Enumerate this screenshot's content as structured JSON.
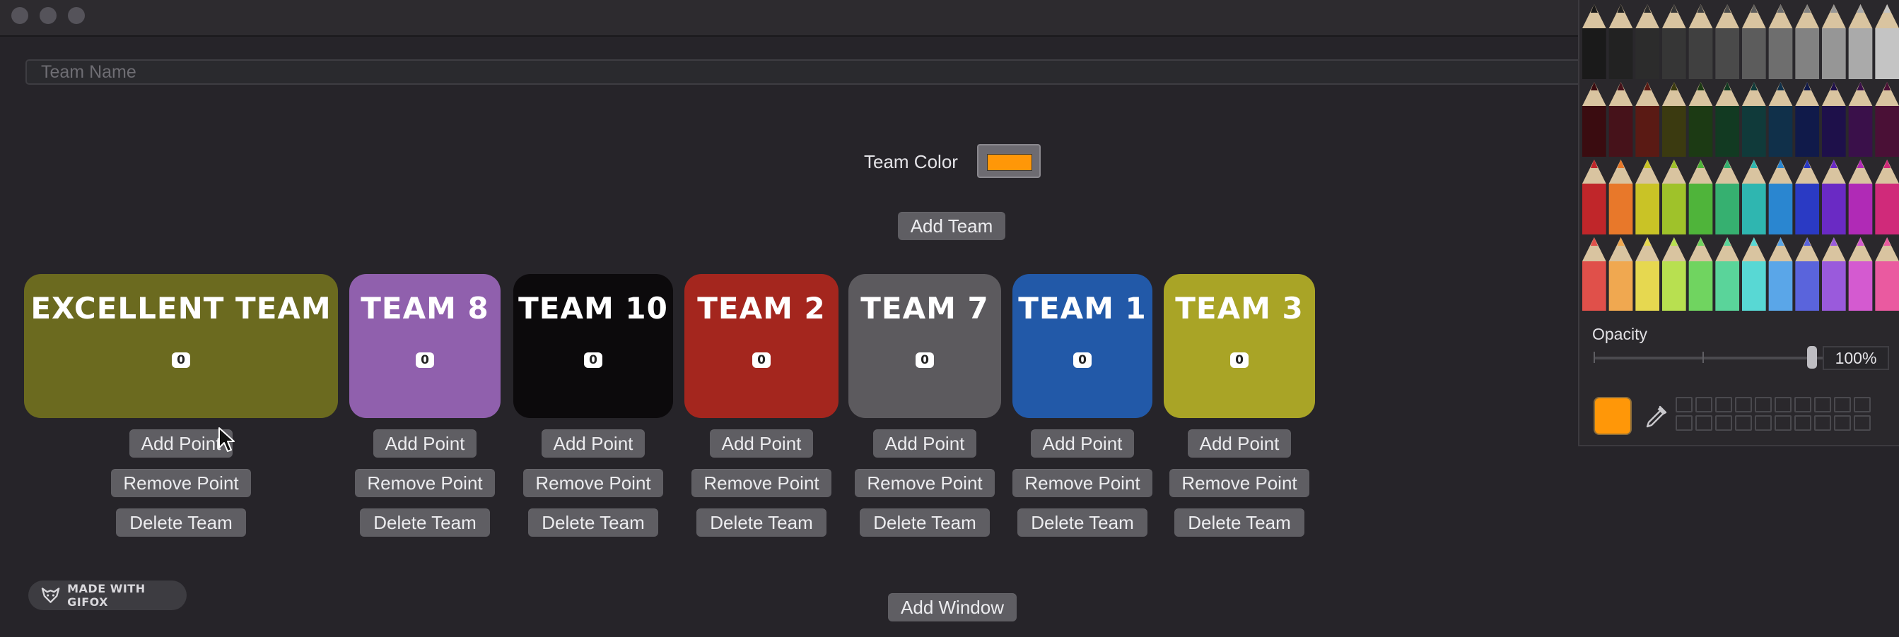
{
  "team_name": {
    "placeholder": "Team Name"
  },
  "team_color": {
    "label": "Team Color",
    "value": "#ff9708"
  },
  "add_team_label": "Add Team",
  "add_window_label": "Add Window",
  "card_buttons": {
    "add_point": "Add Point",
    "remove_point": "Remove Point",
    "delete_team": "Delete Team"
  },
  "teams": [
    {
      "name": "EXCELLENT TEAM",
      "points": "0",
      "color": "#6b6a1f"
    },
    {
      "name": "TEAM 8",
      "points": "0",
      "color": "#9060ad"
    },
    {
      "name": "TEAM 10",
      "points": "0",
      "color": "#0c0a0c"
    },
    {
      "name": "TEAM 2",
      "points": "0",
      "color": "#a4261e"
    },
    {
      "name": "TEAM 7",
      "points": "0",
      "color": "#5c5a5e"
    },
    {
      "name": "TEAM 1",
      "points": "0",
      "color": "#2259a8"
    },
    {
      "name": "TEAM 3",
      "points": "0",
      "color": "#a9a426"
    }
  ],
  "gifox_badge": "MADE WITH GIFOX",
  "color_panel": {
    "opacity_label": "Opacity",
    "opacity_value": "100%",
    "current_color": "#ff9708"
  }
}
